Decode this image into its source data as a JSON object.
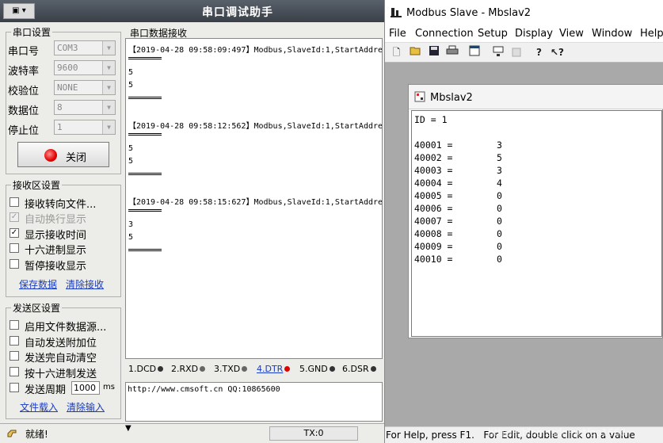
{
  "serial": {
    "title": "串口调试助手",
    "port_settings": {
      "label": "串口设置",
      "fields": [
        {
          "label": "串口号",
          "value": "COM3"
        },
        {
          "label": "波特率",
          "value": "9600"
        },
        {
          "label": "校验位",
          "value": "NONE"
        },
        {
          "label": "数据位",
          "value": "8"
        },
        {
          "label": "停止位",
          "value": "1"
        }
      ],
      "close_button": "关闭"
    },
    "receive_settings": {
      "label": "接收区设置",
      "options": [
        {
          "label": "接收转向文件...",
          "checked": false,
          "disabled": false
        },
        {
          "label": "自动换行显示",
          "checked": true,
          "disabled": true
        },
        {
          "label": "显示接收时间",
          "checked": true,
          "disabled": false
        },
        {
          "label": "十六进制显示",
          "checked": false,
          "disabled": false
        },
        {
          "label": "暂停接收显示",
          "checked": false,
          "disabled": false
        }
      ],
      "save_link": "保存数据",
      "clear_link": "清除接收"
    },
    "send_settings": {
      "label": "发送区设置",
      "options": [
        {
          "label": "启用文件数据源...",
          "checked": false
        },
        {
          "label": "自动发送附加位",
          "checked": false
        },
        {
          "label": "发送完自动清空",
          "checked": false
        },
        {
          "label": "按十六进制发送",
          "checked": false
        },
        {
          "label": "发送周期",
          "checked": false
        }
      ],
      "period_value": "1000",
      "period_unit": "ms",
      "load_link": "文件载入",
      "clear_link": "清除输入"
    },
    "receive_panel": {
      "label": "串口数据接收",
      "records": [
        {
          "header": "【2019-04-28 09:58:09:497】Modbus,SlaveId:1,StartAddre",
          "lines": [
            "5",
            "5"
          ]
        },
        {
          "header": "【2019-04-28 09:58:12:562】Modbus,SlaveId:1,StartAddre",
          "lines": [
            "5",
            "5"
          ]
        },
        {
          "header": "【2019-04-28 09:58:15:627】Modbus,SlaveId:1,StartAddre",
          "lines": [
            "3",
            "5"
          ]
        }
      ]
    },
    "pins": [
      {
        "label": "1.DCD",
        "color": "#222222",
        "link": false
      },
      {
        "label": "2.RXD",
        "color": "#666666",
        "link": false
      },
      {
        "label": "3.TXD",
        "color": "#666666",
        "link": false
      },
      {
        "label": "4.DTR",
        "color": "#e00000",
        "link": true
      },
      {
        "label": "5.GND",
        "color": "#222222",
        "link": false
      },
      {
        "label": "6.DSR",
        "color": "#222222",
        "link": false
      }
    ],
    "send_text": "http://www.cmsoft.cn QQ:10865600",
    "status": "就绪!",
    "tx": "TX:0"
  },
  "modbus": {
    "title": "Modbus Slave - Mbslav2",
    "menus": [
      "File",
      "Connection",
      "Setup",
      "Display",
      "View",
      "Window",
      "Help"
    ],
    "child_title": "Mbslav2",
    "id_line": "ID = 1",
    "registers": [
      {
        "address": "40001",
        "value": "3"
      },
      {
        "address": "40002",
        "value": "5"
      },
      {
        "address": "40003",
        "value": "3"
      },
      {
        "address": "40004",
        "value": "4"
      },
      {
        "address": "40005",
        "value": "0"
      },
      {
        "address": "40006",
        "value": "0"
      },
      {
        "address": "40007",
        "value": "0"
      },
      {
        "address": "40008",
        "value": "0"
      },
      {
        "address": "40009",
        "value": "0"
      },
      {
        "address": "40010",
        "value": "0"
      }
    ],
    "status": "For Help, press F1.   For Edit, double click on a value",
    "watermark": "https://blog.csdn.net/qq1666"
  }
}
